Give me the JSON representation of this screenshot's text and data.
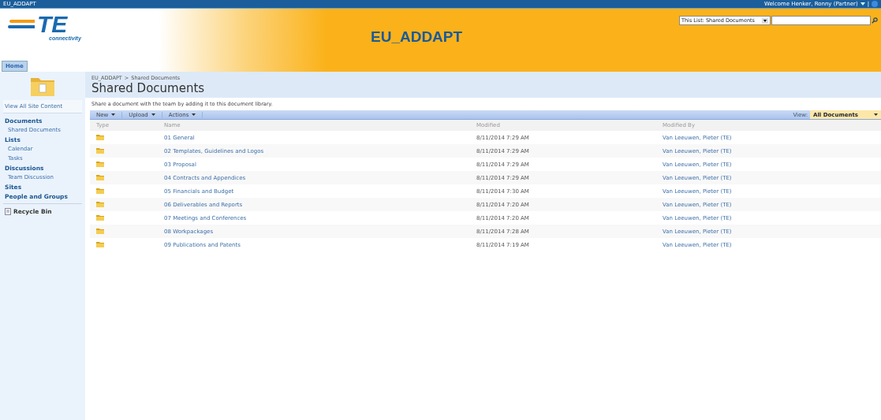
{
  "top_bar": {
    "site": "EU_ADDAPT",
    "welcome": "Welcome Henker, Ronny (Partner)",
    "separator": "|"
  },
  "header": {
    "logo_text": "TE",
    "logo_sub": "connectivity",
    "title": "EU_ADDAPT",
    "scope": "This List: Shared Documents"
  },
  "tabs": [
    {
      "label": "Home",
      "selected": true
    }
  ],
  "breadcrumb": [
    "EU_ADDAPT",
    ">",
    "Shared Documents"
  ],
  "page_title": "Shared Documents",
  "description": "Share a document with the team by adding it to this document library.",
  "sidebar": {
    "items": [
      {
        "kind": "link",
        "label": "View All Site Content"
      },
      {
        "kind": "heading",
        "label": "Documents"
      },
      {
        "kind": "item",
        "label": "Shared Documents"
      },
      {
        "kind": "heading",
        "label": "Lists"
      },
      {
        "kind": "item",
        "label": "Calendar"
      },
      {
        "kind": "item",
        "label": "Tasks"
      },
      {
        "kind": "heading",
        "label": "Discussions"
      },
      {
        "kind": "item",
        "label": "Team Discussion"
      },
      {
        "kind": "heading",
        "label": "Sites"
      },
      {
        "kind": "heading",
        "label": "People and Groups"
      },
      {
        "kind": "recycle",
        "label": "Recycle Bin"
      }
    ]
  },
  "toolbar": {
    "menus": [
      "New",
      "Upload",
      "Actions"
    ],
    "view_label": "View:",
    "view": "All Documents"
  },
  "table": {
    "columns": [
      "Type",
      "Name",
      "Modified",
      "Modified By"
    ],
    "rows": [
      {
        "name": "01 General",
        "modified": "8/11/2014 7:29 AM",
        "modified_by": "Van Leeuwen, Pieter (TE)"
      },
      {
        "name": "02 Templates, Guidelines and Logos",
        "modified": "8/11/2014 7:29 AM",
        "modified_by": "Van Leeuwen, Pieter (TE)"
      },
      {
        "name": "03 Proposal",
        "modified": "8/11/2014 7:29 AM",
        "modified_by": "Van Leeuwen, Pieter (TE)"
      },
      {
        "name": "04 Contracts and Appendices",
        "modified": "8/11/2014 7:29 AM",
        "modified_by": "Van Leeuwen, Pieter (TE)"
      },
      {
        "name": "05 Financials and Budget",
        "modified": "8/11/2014 7:30 AM",
        "modified_by": "Van Leeuwen, Pieter (TE)"
      },
      {
        "name": "06 Deliverables and Reports",
        "modified": "8/11/2014 7:20 AM",
        "modified_by": "Van Leeuwen, Pieter (TE)"
      },
      {
        "name": "07 Meetings and Conferences",
        "modified": "8/11/2014 7:20 AM",
        "modified_by": "Van Leeuwen, Pieter (TE)"
      },
      {
        "name": "08 Workpackages",
        "modified": "8/11/2014 7:28 AM",
        "modified_by": "Van Leeuwen, Pieter (TE)"
      },
      {
        "name": "09 Publications and Patents",
        "modified": "8/11/2014 7:19 AM",
        "modified_by": "Van Leeuwen, Pieter (TE)"
      }
    ]
  }
}
